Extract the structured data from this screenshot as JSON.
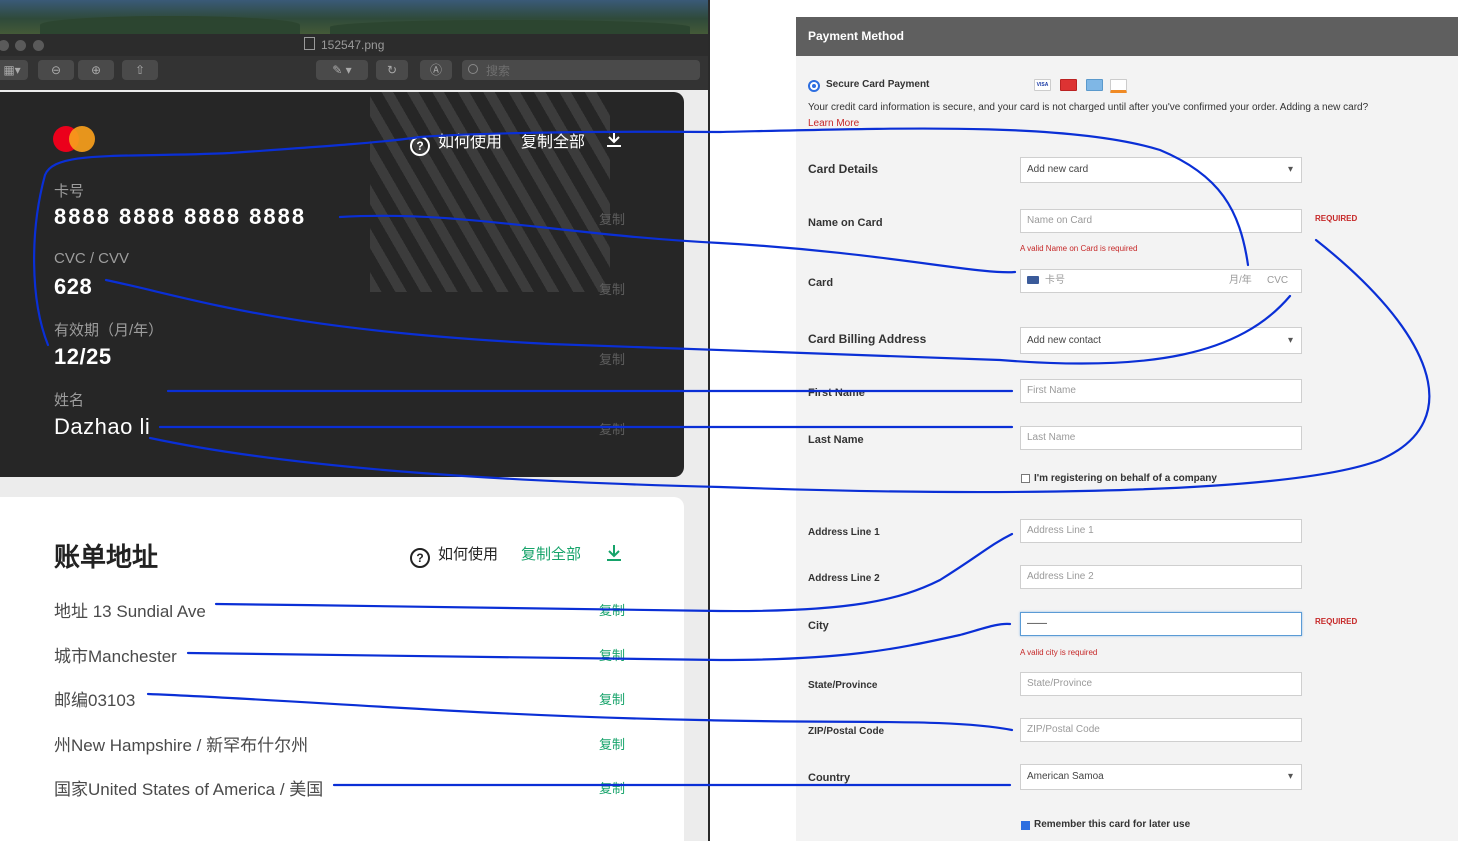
{
  "viewer": {
    "file_name": "152547.png",
    "search_placeholder": "搜索",
    "card": {
      "how_to_use": "如何使用",
      "copy_all": "复制全部",
      "fields": [
        {
          "label": "卡号",
          "value": "8888 8888 8888 8888",
          "copy": "复制"
        },
        {
          "label": "CVC / CVV",
          "value": "628",
          "copy": "复制"
        },
        {
          "label": "有效期（月/年）",
          "value": "12/25",
          "copy": "复制"
        },
        {
          "label": "姓名",
          "value": "Dazhao li",
          "copy": "复制"
        }
      ]
    },
    "billing": {
      "title": "账单地址",
      "how_to_use": "如何使用",
      "copy_all": "复制全部",
      "rows": [
        {
          "text": "地址 13 Sundial Ave",
          "copy": "复制"
        },
        {
          "text": "城市Manchester",
          "copy": "复制"
        },
        {
          "text": "邮编03103",
          "copy": "复制"
        },
        {
          "text": "州New Hampshire / 新罕布什尔州",
          "copy": "复制"
        },
        {
          "text": "国家United States of America / 美国",
          "copy": "复制"
        }
      ]
    }
  },
  "form": {
    "header": "Payment Method",
    "secure_option": "Secure Card Payment",
    "accepted_cards": [
      "visa-icon",
      "mastercard-icon",
      "amex-icon",
      "discover-icon"
    ],
    "security_note": "Your credit card information is secure, and your card is not charged until after you've confirmed your order. Adding a new card?",
    "learn_more": "Learn More",
    "card_details_label": "Card Details",
    "card_details_value": "Add new card",
    "name_on_card_label": "Name on Card",
    "name_on_card_placeholder": "Name on Card",
    "name_error": "A valid Name on Card is required",
    "required": "REQUIRED",
    "card_label": "Card",
    "card_number_placeholder": "卡号",
    "card_expiry_placeholder": "月/年",
    "card_cvc_placeholder": "CVC",
    "billing_address_label": "Card Billing Address",
    "billing_address_value": "Add new contact",
    "first_name_label": "First Name",
    "first_name_placeholder": "First Name",
    "last_name_label": "Last Name",
    "last_name_placeholder": "Last Name",
    "company_checkbox": "I'm registering on behalf of a company",
    "address1_label": "Address Line 1",
    "address1_placeholder": "Address Line 1",
    "address2_label": "Address Line 2",
    "address2_placeholder": "Address Line 2",
    "city_label": "City",
    "city_value": "——",
    "city_error": "A valid city is required",
    "state_label": "State/Province",
    "state_placeholder": "State/Province",
    "zip_label": "ZIP/Postal Code",
    "zip_placeholder": "ZIP/Postal Code",
    "country_label": "Country",
    "country_value": "American Samoa",
    "remember_card": "Remember this card for later use"
  },
  "colors": {
    "annotation": "#0a2fd6",
    "copy_green": "#16a36a",
    "error_red": "#c62828",
    "header_gray": "#5f5f5f"
  }
}
